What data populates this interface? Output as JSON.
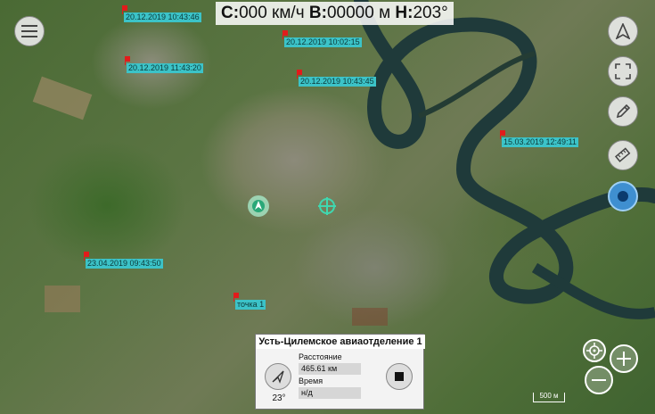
{
  "speedbar": {
    "speed_label": "С:",
    "speed_value": "000 км/ч",
    "alt_label": "В:",
    "alt_value": "00000 м",
    "heading_label": "Н:",
    "heading_value": "203°"
  },
  "waypoints": [
    {
      "label": "20.12.2019 10:43:46"
    },
    {
      "label": "20.12.2019 10:02:15"
    },
    {
      "label": "20.12.2019 11:43:20"
    },
    {
      "label": "20.12.2019 10:43:45"
    },
    {
      "label": "15.03.2019 12:49:11"
    },
    {
      "label": "23.04.2019 09:43:50"
    },
    {
      "label": "точка 1"
    }
  ],
  "info_panel": {
    "title": "Усть-Цилемское авиаотделение 1",
    "distance_label": "Расстояние",
    "distance_value": "465.61 км",
    "time_label": "Время",
    "time_value": "н/д",
    "heading_value": "23°"
  },
  "scale": {
    "label": "500 м"
  },
  "icons": {
    "menu": "menu-icon",
    "navigate": "navigation-arrow-icon",
    "fullscreen": "fullscreen-icon",
    "edit": "pencil-icon",
    "ruler": "ruler-icon",
    "record": "record-icon",
    "locate": "locate-icon",
    "zoom_in": "plus-icon",
    "zoom_out": "minus-icon",
    "stop": "stop-icon"
  },
  "colors": {
    "waypoint_label_bg": "#3cc3c8",
    "flag": "#e21b1b",
    "record_button": "#3f8fd0",
    "river": "#1f3a3a"
  }
}
